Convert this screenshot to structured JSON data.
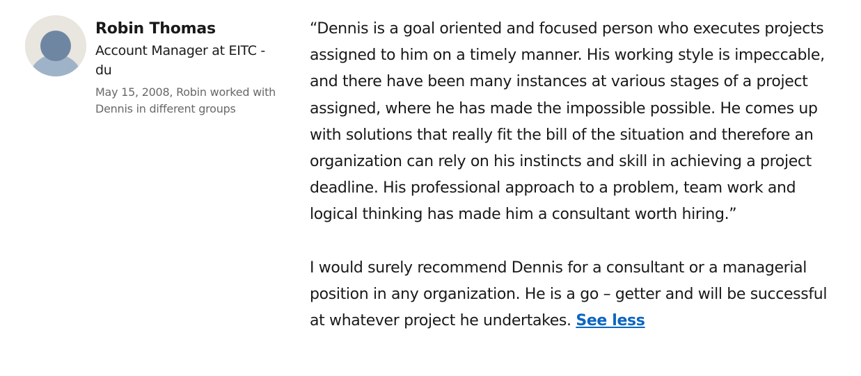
{
  "recommendation": {
    "author": {
      "name": "Robin Thomas",
      "headline": "Account Manager at EITC - du",
      "meta": "May 15, 2008, Robin worked with Dennis in different groups",
      "avatar_icon": "default-person-avatar-icon"
    },
    "text": {
      "paragraph_1": "“Dennis is a goal oriented and focused person who executes projects assigned to him on a timely manner. His working style is impeccable, and there have been many instances at various stages of a project assigned, where he has made the impossible possible. He comes up with solutions that really fit the bill of the situation and therefore an organization can rely on his instincts and skill in achieving a project deadline. His professional approach to a problem, team work and logical thinking has made him a consultant worth hiring.”",
      "paragraph_2": "I would surely recommend Dennis for a consultant or a managerial position in any organization. He is a go – getter and will be successful at whatever project he undertakes.",
      "see_less_label": "See less"
    }
  },
  "colors": {
    "avatar_background": "#e9e5df",
    "avatar_head": "#6f86a3",
    "avatar_body": "#9fb3c8",
    "link": "#0a66c2"
  }
}
